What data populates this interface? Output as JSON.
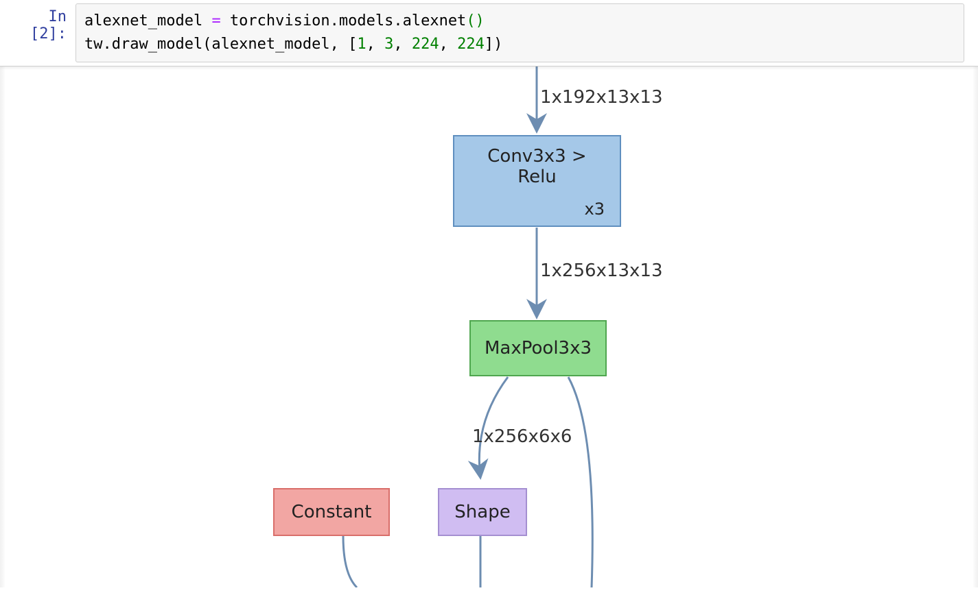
{
  "cell": {
    "prompt": "In [2]:",
    "code": {
      "line1": {
        "t1": "alexnet_model ",
        "op": "=",
        "t2": " torchvision.models.alexnet",
        "paren": "()"
      },
      "line2": {
        "t1": "tw.draw_model(alexnet_model, [",
        "n1": "1",
        "c1": ", ",
        "n2": "3",
        "c2": ", ",
        "n3": "224",
        "c3": ", ",
        "n4": "224",
        "t2": "])"
      }
    }
  },
  "graph": {
    "edge_labels": {
      "e1": "1x192x13x13",
      "e2": "1x256x13x13",
      "e3": "1x256x6x6"
    },
    "nodes": {
      "conv": {
        "label": "Conv3x3 > Relu",
        "sub": "x3"
      },
      "maxpool": {
        "label": "MaxPool3x3"
      },
      "constant": {
        "label": "Constant"
      },
      "shape": {
        "label": "Shape"
      }
    },
    "colors": {
      "arrow": "#6d8db1"
    }
  }
}
